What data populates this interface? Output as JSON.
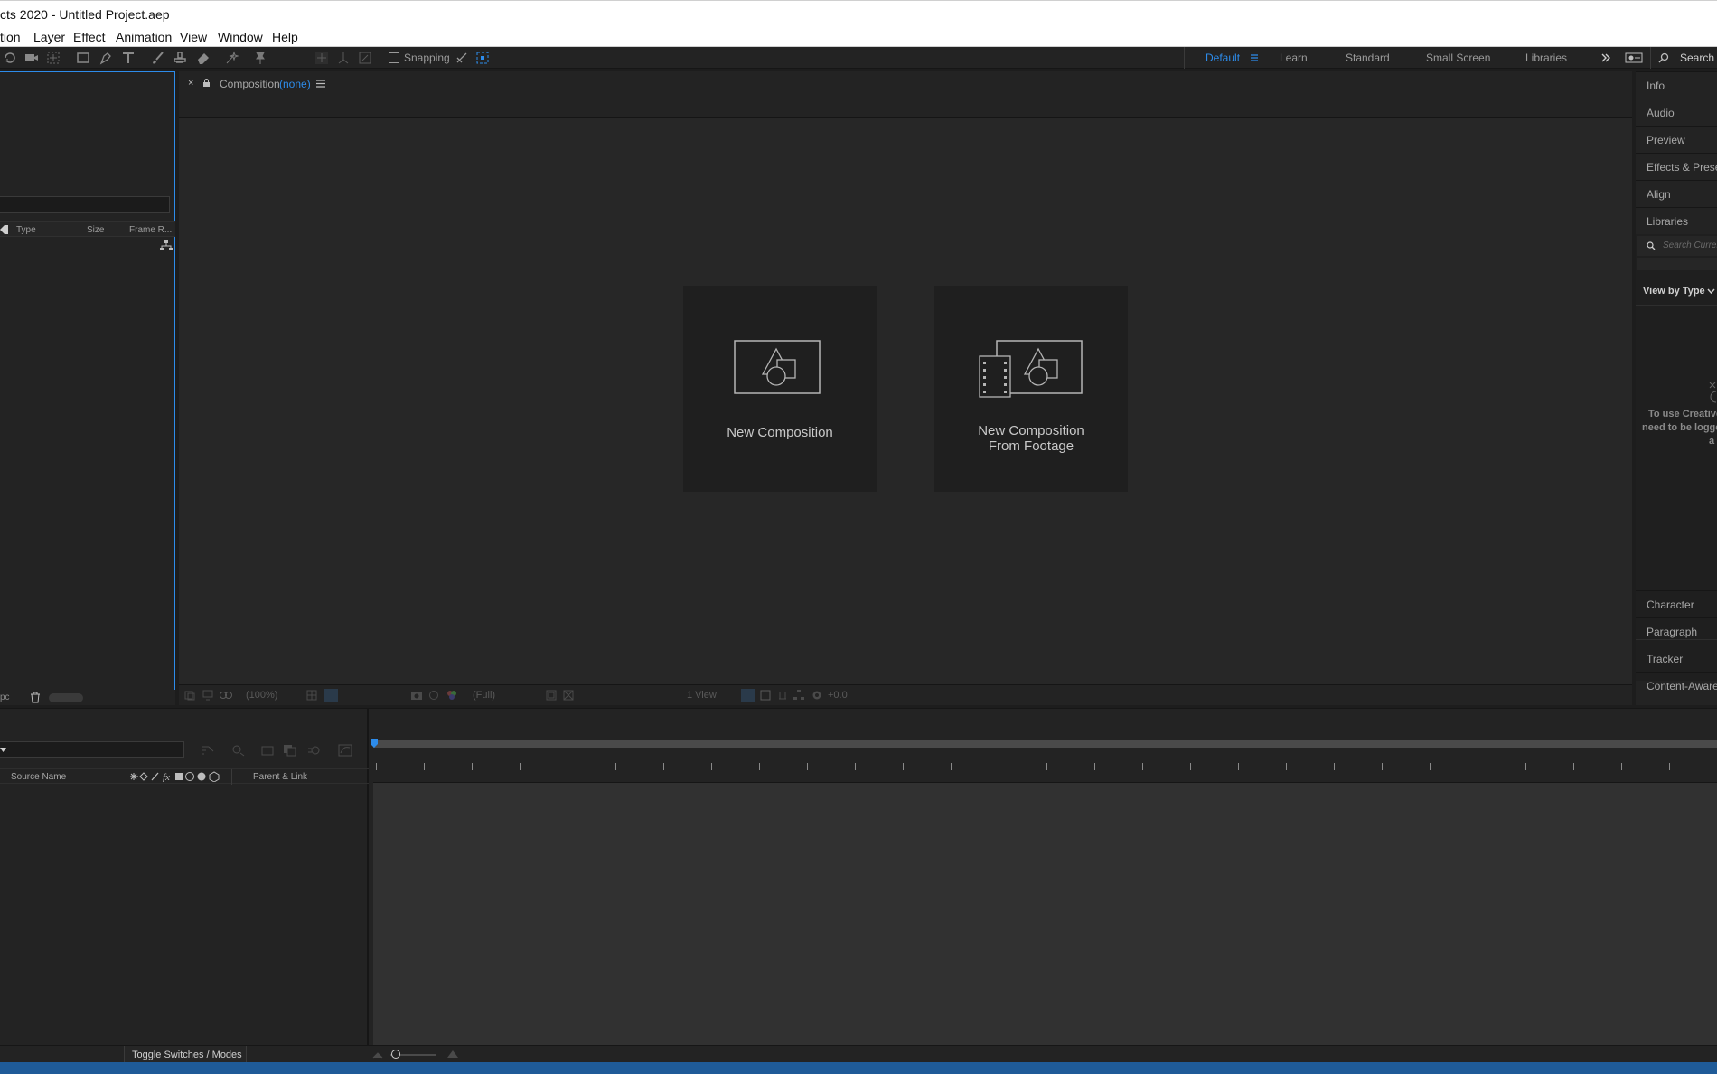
{
  "window": {
    "title": "cts 2020 - Untitled Project.aep"
  },
  "menu": [
    "tion",
    "Layer",
    "Effect",
    "Animation",
    "View",
    "Window",
    "Help"
  ],
  "toolbar": {
    "snapping_label": "Snapping"
  },
  "workspaces": [
    "Default",
    "Learn",
    "Standard",
    "Small Screen",
    "Libraries"
  ],
  "search_help": {
    "placeholder": "Search H"
  },
  "project": {
    "columns": [
      "Type",
      "Size",
      "Frame R..."
    ],
    "footer_label": "pc"
  },
  "composition": {
    "tab_label": "Composition",
    "tab_value": "(none)",
    "new_comp": "New Composition",
    "new_comp_footage_line1": "New Composition",
    "new_comp_footage_line2": "From Footage",
    "footer": {
      "zoom": "(100%)",
      "resolution": "(Full)",
      "views": "1 View",
      "exposure": "+0.0"
    }
  },
  "right_panels": {
    "top": [
      "Info",
      "Audio",
      "Preview",
      "Effects & Presets",
      "Align",
      "Libraries"
    ],
    "libraries_search_placeholder": "Search Current",
    "view_by": "View by Type",
    "message_lines": [
      "To use Creative",
      "need to be logge",
      "a"
    ],
    "bottom": [
      "Character",
      "Paragraph",
      "Tracker",
      "Content-Aware"
    ]
  },
  "timeline": {
    "source_name": "Source Name",
    "parent_link": "Parent & Link",
    "toggle_label": "Toggle Switches / Modes"
  },
  "colors": {
    "accent": "#2d8ceb",
    "status_bar": "#1f5b98"
  }
}
